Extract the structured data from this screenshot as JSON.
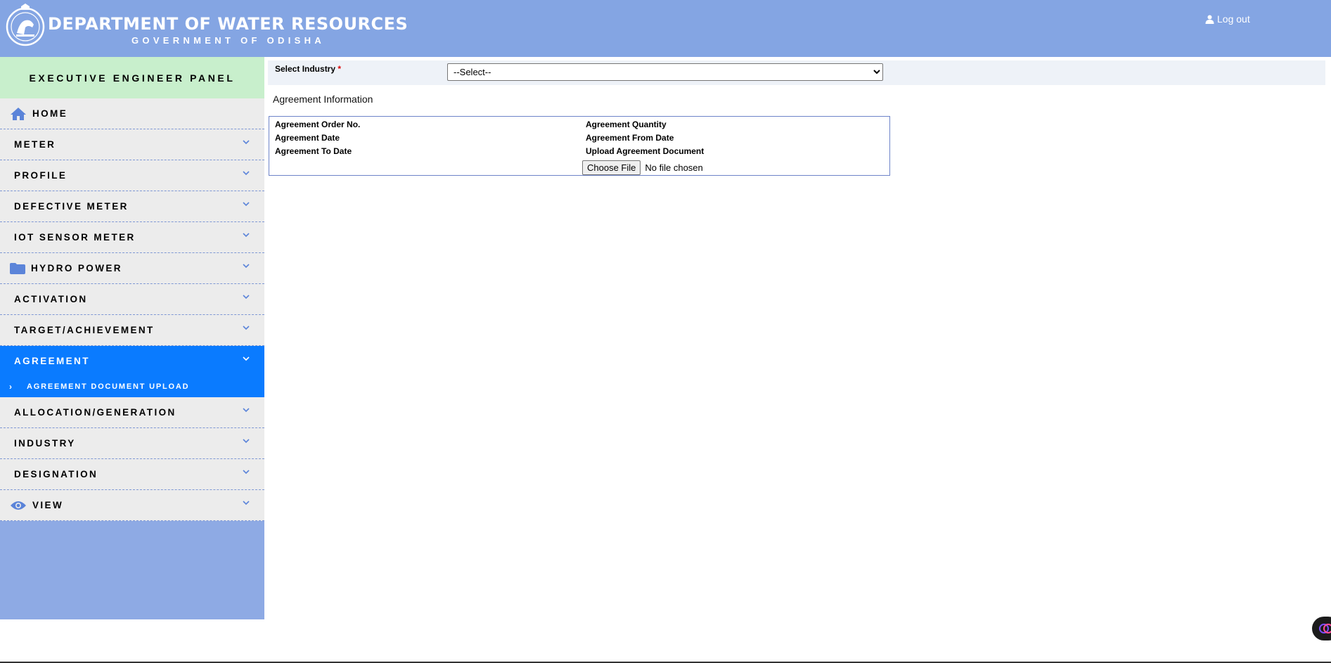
{
  "header": {
    "title": "DEPARTMENT OF WATER RESOURCES",
    "subtitle": "GOVERNMENT OF ODISHA",
    "logout_label": "Log out"
  },
  "sidebar": {
    "panel_title": "EXECUTIVE ENGINEER PANEL",
    "items": [
      {
        "label": "HOME",
        "icon": "home-icon"
      },
      {
        "label": "METER"
      },
      {
        "label": "PROFILE"
      },
      {
        "label": "DEFECTIVE METER"
      },
      {
        "label": "IOT SENSOR METER"
      },
      {
        "label": "HYDRO POWER",
        "icon": "folder-icon"
      },
      {
        "label": "ACTIVATION"
      },
      {
        "label": "TARGET/ACHIEVEMENT"
      },
      {
        "label": "AGREEMENT",
        "active": true
      },
      {
        "label": "ALLOCATION/GENERATION"
      },
      {
        "label": "INDUSTRY"
      },
      {
        "label": "DESIGNATION"
      },
      {
        "label": "VIEW",
        "icon": "eye-icon"
      }
    ],
    "subitems": [
      {
        "label": "AGREEMENT DOCUMENT UPLOAD"
      }
    ]
  },
  "main": {
    "industry_label": "Select Industry",
    "required_mark": "*",
    "industry_select_value": "--Select--",
    "section_title": "Agreement  Information",
    "fields": {
      "order_no": "Agreement Order No.",
      "quantity": "Agreement Quantity",
      "date": "Agreement Date",
      "from_date": "Agreement From Date",
      "to_date": "Agreement To Date",
      "upload_doc": "Upload Agreement Document"
    },
    "file_button_label": "Choose File",
    "file_status": "No file chosen"
  },
  "colors": {
    "header_bg": "#84a5e3",
    "panel_title_bg": "#c8efcc",
    "active_bg": "#0a7bff",
    "nav_bg": "#ececec"
  }
}
